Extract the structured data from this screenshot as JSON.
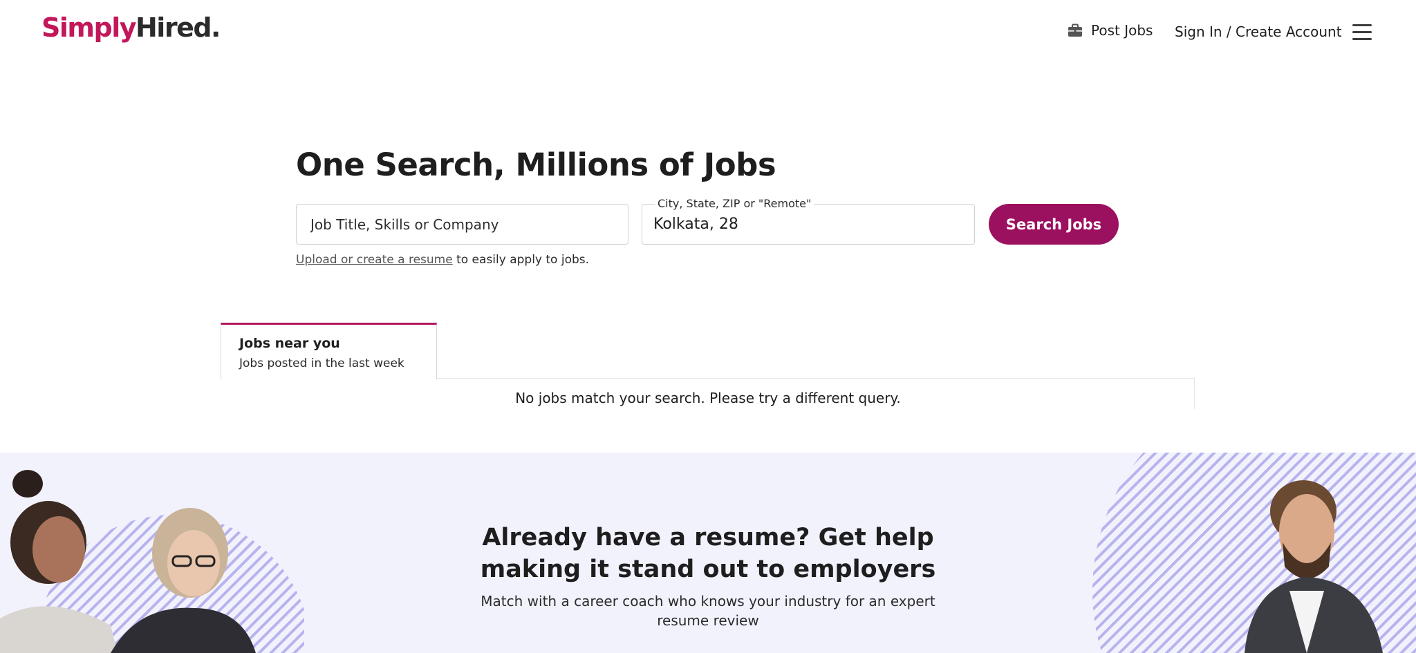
{
  "header": {
    "logo_part1": "Simply",
    "logo_part2": "Hired.",
    "post_jobs": "Post Jobs",
    "sign_in": "Sign In / Create Account"
  },
  "hero": {
    "title": "One Search, Millions of Jobs",
    "what_placeholder": "Job Title, Skills or Company",
    "where_label": "City, State, ZIP or \"Remote\"",
    "where_value": "Kolkata, 28",
    "search_button": "Search Jobs",
    "resume_link": "Upload or create a resume",
    "resume_rest": " to easily apply to jobs."
  },
  "tabs": [
    {
      "title": "Jobs near you",
      "subtitle": "Jobs posted in the last week"
    }
  ],
  "results": {
    "empty_message": "No jobs match your search. Please try a different query."
  },
  "promo": {
    "title_line1": "Already have a resume? Get help",
    "title_line2": "making it stand out to employers",
    "sub_line1": "Match with a career coach who knows your industry for an expert",
    "sub_line2": "resume review"
  },
  "colors": {
    "brand": "#9c1060",
    "logo_accent": "#c2185b",
    "promo_bg": "#f2f2fd",
    "stripe": "#b7b3ee"
  },
  "icons": [
    "briefcase-icon",
    "menu-icon"
  ]
}
